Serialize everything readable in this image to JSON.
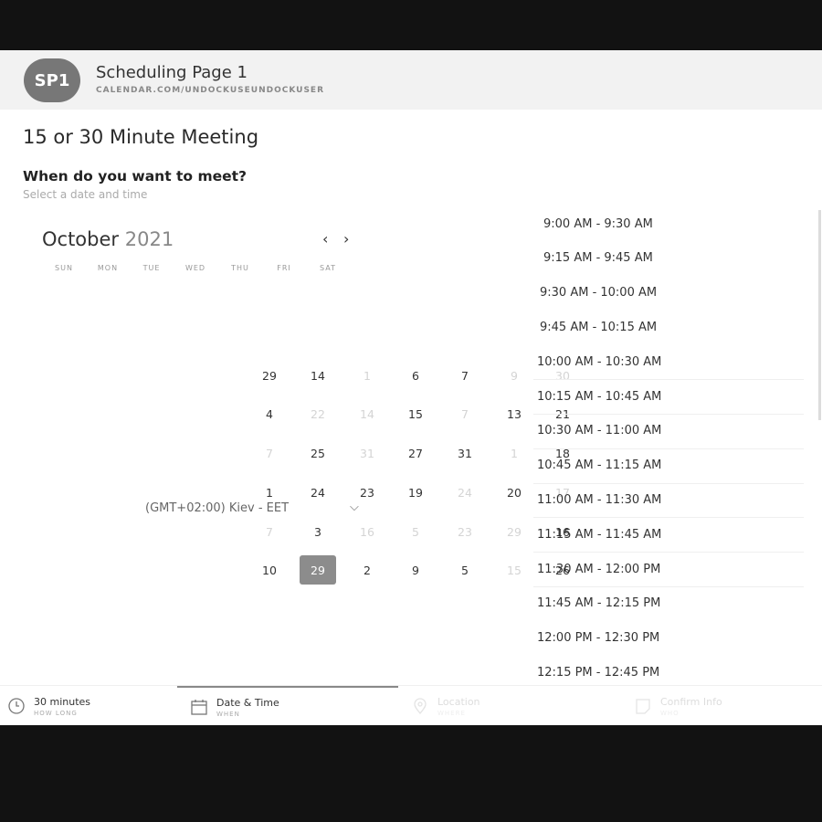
{
  "header": {
    "avatar_initials": "SP1",
    "page_name": "Scheduling Page 1",
    "page_url": "CALENDAR.COM/UNDOCKUSEUNDOCKUSER"
  },
  "meeting_title": "15 or 30 Minute Meeting",
  "question": "When do you want to meet?",
  "subhint": "Select a date and time",
  "calendar": {
    "month": "October",
    "year": "2021",
    "prev_icon": "‹",
    "next_icon": "›",
    "weekdays": [
      "SUN",
      "MON",
      "TUE",
      "WED",
      "THU",
      "FRI",
      "SAT"
    ],
    "days": [
      {
        "label": "29",
        "state": "normal"
      },
      {
        "label": "14",
        "state": "normal"
      },
      {
        "label": "1",
        "state": "faint"
      },
      {
        "label": "6",
        "state": "normal"
      },
      {
        "label": "7",
        "state": "normal"
      },
      {
        "label": "9",
        "state": "faint"
      },
      {
        "label": "30",
        "state": "faint"
      },
      {
        "label": "4",
        "state": "normal"
      },
      {
        "label": "22",
        "state": "faint"
      },
      {
        "label": "14",
        "state": "faint"
      },
      {
        "label": "15",
        "state": "normal"
      },
      {
        "label": "7",
        "state": "faint"
      },
      {
        "label": "13",
        "state": "normal"
      },
      {
        "label": "21",
        "state": "normal"
      },
      {
        "label": "7",
        "state": "faint"
      },
      {
        "label": "25",
        "state": "normal"
      },
      {
        "label": "31",
        "state": "faint"
      },
      {
        "label": "27",
        "state": "normal"
      },
      {
        "label": "31",
        "state": "normal"
      },
      {
        "label": "1",
        "state": "faint"
      },
      {
        "label": "18",
        "state": "normal"
      },
      {
        "label": "1",
        "state": "normal"
      },
      {
        "label": "24",
        "state": "normal"
      },
      {
        "label": "23",
        "state": "normal"
      },
      {
        "label": "19",
        "state": "normal"
      },
      {
        "label": "24",
        "state": "faint"
      },
      {
        "label": "20",
        "state": "normal"
      },
      {
        "label": "17",
        "state": "faint"
      },
      {
        "label": "7",
        "state": "faint"
      },
      {
        "label": "3",
        "state": "normal"
      },
      {
        "label": "16",
        "state": "faint"
      },
      {
        "label": "5",
        "state": "faint"
      },
      {
        "label": "23",
        "state": "faint"
      },
      {
        "label": "29",
        "state": "faint"
      },
      {
        "label": "16",
        "state": "normal"
      },
      {
        "label": "10",
        "state": "normal"
      },
      {
        "label": "29",
        "state": "selected"
      },
      {
        "label": "2",
        "state": "normal"
      },
      {
        "label": "9",
        "state": "normal"
      },
      {
        "label": "5",
        "state": "normal"
      },
      {
        "label": "15",
        "state": "faint"
      },
      {
        "label": "26",
        "state": "normal"
      }
    ]
  },
  "timezone": {
    "label": "(GMT+02:00) Kiev - EET",
    "chevron": "⌵"
  },
  "time_slots": [
    "9:00 AM - 9:30 AM",
    "9:15 AM - 9:45 AM",
    "9:30 AM - 10:00 AM",
    "9:45 AM - 10:15 AM",
    "10:00 AM - 10:30 AM",
    "10:15 AM - 10:45 AM",
    "10:30 AM - 11:00 AM",
    "10:45 AM - 11:15 AM",
    "11:00 AM - 11:30 AM",
    "11:15 AM - 11:45 AM",
    "11:30 AM - 12:00 PM",
    "11:45 AM - 12:15 PM",
    "12:00 PM - 12:30 PM",
    "12:15 PM - 12:45 PM"
  ],
  "tabs": [
    {
      "title": "30 minutes",
      "sub": "HOW LONG",
      "icon": "clock-icon"
    },
    {
      "title": "Date & Time",
      "sub": "WHEN",
      "icon": "calendar-icon"
    },
    {
      "title": "Location",
      "sub": "WHERE",
      "icon": "location-pin-icon"
    },
    {
      "title": "Confirm Info",
      "sub": "WHO",
      "icon": "document-icon"
    }
  ]
}
